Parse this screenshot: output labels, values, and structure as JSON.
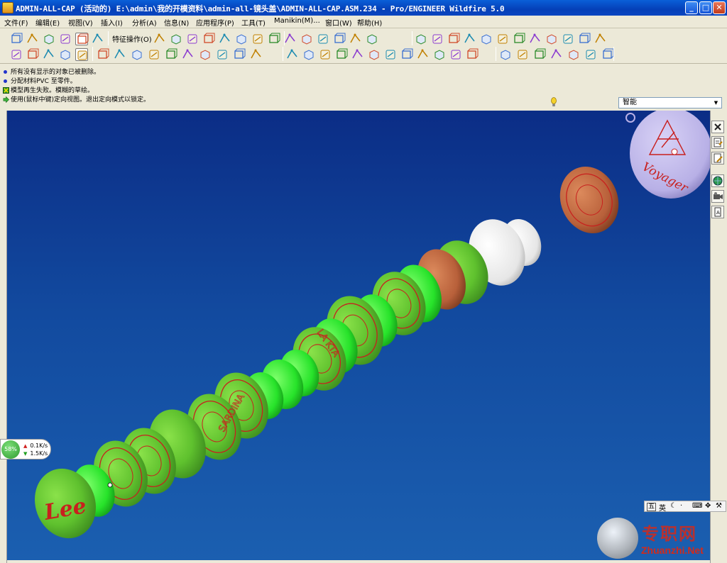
{
  "window": {
    "title": "ADMIN-ALL-CAP (活动的) E:\\admin\\我的开模资料\\admin-all-镜头盖\\ADMIN-ALL-CAP.ASM.234 - Pro/ENGINEER Wildfire 5.0",
    "minimize": "_",
    "maximize": "□",
    "close": "✕"
  },
  "menu": [
    "文件(F)",
    "编辑(E)",
    "视图(V)",
    "插入(I)",
    "分析(A)",
    "信息(N)",
    "应用程序(P)",
    "工具(T)",
    "Manikin(M)...",
    "窗口(W)",
    "帮助(H)"
  ],
  "toolbar": {
    "feature_ops_label": "特征操作(O)"
  },
  "messages": [
    {
      "icon": "bullet-icon",
      "text": "所有没有显示的对象已被删除。"
    },
    {
      "icon": "bullet-icon",
      "text": "分配材料PVC 至零件。"
    },
    {
      "icon": "regen-fail-icon",
      "text": "模型再生失败。模糊的草绘。"
    },
    {
      "icon": "arrow-prompt-icon",
      "text": "使用(鼠标中键)定向视图。退出定向模式以锁定。"
    }
  ],
  "filter": {
    "value": "智能"
  },
  "model_text": {
    "lee": "Lee",
    "voyager": "Voyager",
    "sardina": "SARDINA",
    "lakta": "LA KTA"
  },
  "net": {
    "percent": "58%",
    "up": "0.1K/s",
    "down": "1.5K/s"
  },
  "ime": {
    "lang": "英",
    "mode": "五"
  },
  "watermark": {
    "cn": "专职网",
    "en": "Zhuanzhi.Net"
  },
  "colors": {
    "viewport_top": "#0b2d86",
    "viewport_bottom": "#1b5fb0",
    "cap_green": "#5fc12e",
    "ring_green": "#3ce63a",
    "logo_red": "#c8201e",
    "copper": "#b8603a",
    "white_part": "#f2f2f2",
    "tag_purple": "#b8b0e6"
  }
}
